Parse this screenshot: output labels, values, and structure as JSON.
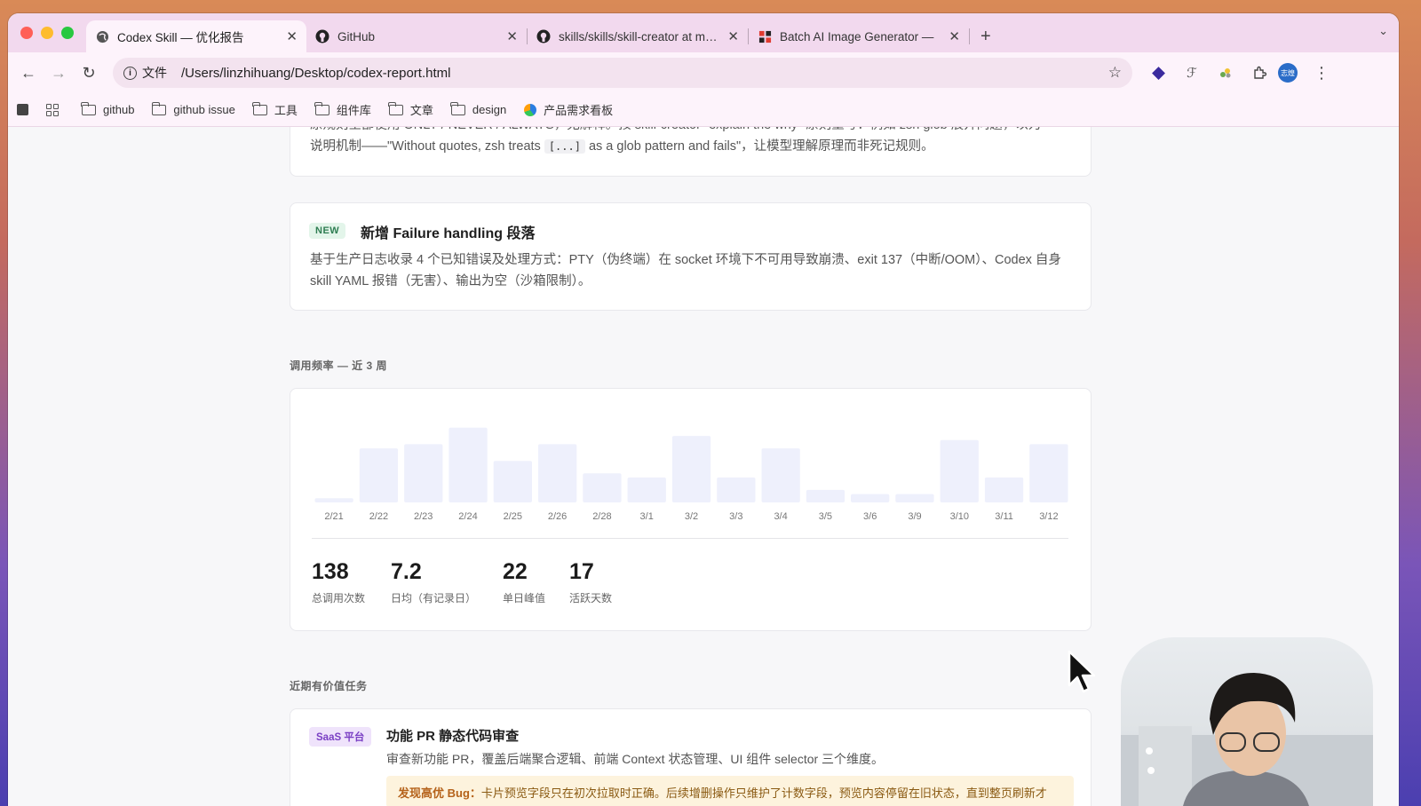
{
  "browser": {
    "tabs": [
      {
        "title": "Codex Skill — 优化报告",
        "active": true
      },
      {
        "title": "GitHub",
        "active": false
      },
      {
        "title": "skills/skills/skill-creator at main",
        "active": false
      },
      {
        "title": "Batch AI Image Generator — ",
        "active": false
      }
    ],
    "scheme_label": "文件",
    "url": "/Users/linzhihuang/Desktop/codex-report.html",
    "avatar_text": "志煌"
  },
  "bookmarks": [
    {
      "label": "github"
    },
    {
      "label": "github issue"
    },
    {
      "label": "工具"
    },
    {
      "label": "组件库"
    },
    {
      "label": "文章"
    },
    {
      "label": "design"
    },
    {
      "label": "产品需求看板"
    }
  ],
  "report": {
    "prev_card": {
      "line1": "原规则全部使用 ONLY / NEVER / ALWAYS，无解释。按 skill-creator \"explain the why\" 原则重写：例如 zsh glob 展开问题，以为",
      "line2_pre": "说明机制——\"Without quotes, zsh treats ",
      "line2_code": "[...]",
      "line2_post": " as a glob pattern and fails\"，让模型理解原理而非死记规则。"
    },
    "new_card": {
      "badge": "NEW",
      "title": "新增 Failure handling 段落",
      "body": "基于生产日志收录 4 个已知错误及处理方式：PTY（伪终端）在 socket 环境下不可用导致崩溃、exit 137（中断/OOM）、Codex 自身 skill YAML 报错（无害）、输出为空（沙箱限制）。"
    },
    "usage_section_label": "调用频率 — 近 3 周",
    "stats": [
      {
        "value": "138",
        "label": "总调用次数"
      },
      {
        "value": "7.2",
        "label": "日均（有记录日）"
      },
      {
        "value": "22",
        "label": "单日峰值"
      },
      {
        "value": "17",
        "label": "活跃天数"
      }
    ],
    "tasks_section_label": "近期有价值任务",
    "task": {
      "badge": "SaaS 平台",
      "title": "功能 PR 静态代码审查",
      "desc": "审查新功能 PR，覆盖后端聚合逻辑、前端 Context 状态管理、UI 组件 selector 三个维度。",
      "bug_label": "发现高优 Bug：",
      "bug_text": "卡片预览字段只在初次拉取时正确。后续增删操作只维护了计数字段，预览内容停留在旧状态，直到整页刷新才"
    }
  },
  "colors": {
    "bar_fill": "#eef0fc",
    "badge_new_bg": "#e3f5ea",
    "badge_saas_bg": "#efe3fb",
    "bug_bg": "#fdf3dd"
  },
  "chart_data": {
    "type": "bar",
    "categories": [
      "2/21",
      "2/22",
      "2/23",
      "2/24",
      "2/25",
      "2/26",
      "2/28",
      "3/1",
      "3/2",
      "3/3",
      "3/4",
      "3/5",
      "3/6",
      "3/9",
      "3/10",
      "3/11",
      "3/12"
    ],
    "values": [
      1,
      13,
      14,
      18,
      10,
      14,
      7,
      6,
      16,
      6,
      13,
      3,
      2,
      2,
      15,
      6,
      14
    ],
    "title": "",
    "xlabel": "",
    "ylabel": "",
    "ylim": [
      0,
      22
    ],
    "grid": false
  }
}
